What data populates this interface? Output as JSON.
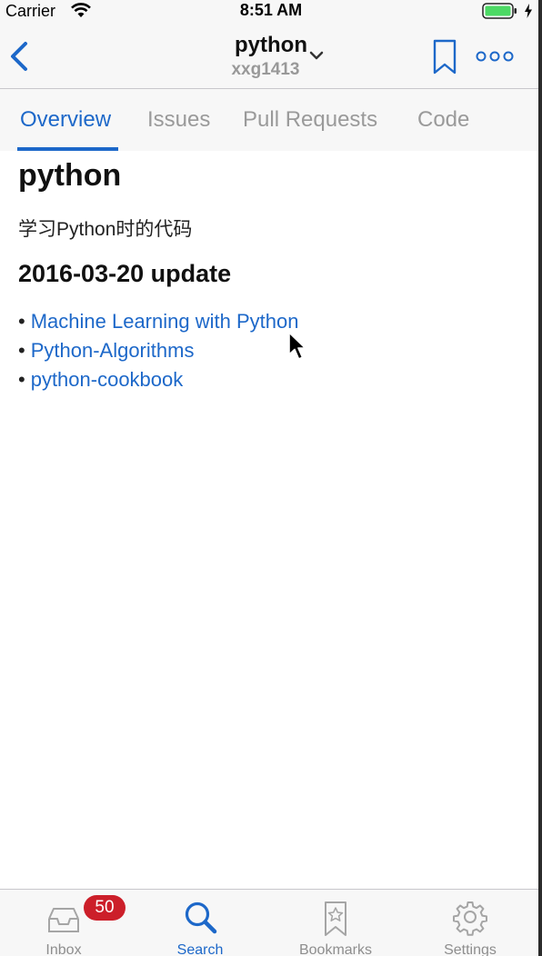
{
  "status_bar": {
    "carrier": "Carrier",
    "time": "8:51 AM"
  },
  "nav": {
    "title": "python",
    "subtitle": "xxg1413"
  },
  "tabs": [
    {
      "label": "Overview",
      "active": true
    },
    {
      "label": "Issues",
      "active": false
    },
    {
      "label": "Pull Requests",
      "active": false
    },
    {
      "label": "Code",
      "active": false
    }
  ],
  "readme": {
    "heading": "python",
    "description": "学习Python时的代码",
    "section_heading": "2016-03-20 update",
    "links": [
      {
        "bullet": "•",
        "label": "Machine Learning with Python"
      },
      {
        "bullet": "•",
        "label": "Python-Algorithms"
      },
      {
        "bullet": "•",
        "label": "python-cookbook"
      }
    ]
  },
  "bottom_tabs": [
    {
      "label": "Inbox",
      "badge": "50",
      "icon": "inbox-icon",
      "active": false
    },
    {
      "label": "Search",
      "icon": "search-icon",
      "active": true
    },
    {
      "label": "Bookmarks",
      "icon": "bookmarks-icon",
      "active": false
    },
    {
      "label": "Settings",
      "icon": "gear-icon",
      "active": false
    }
  ],
  "colors": {
    "accent": "#1d68c9",
    "badge": "#cc1f2a",
    "inactive": "#8e8e8e",
    "bar_background": "#f7f7f7",
    "battery": "#4cd964"
  }
}
